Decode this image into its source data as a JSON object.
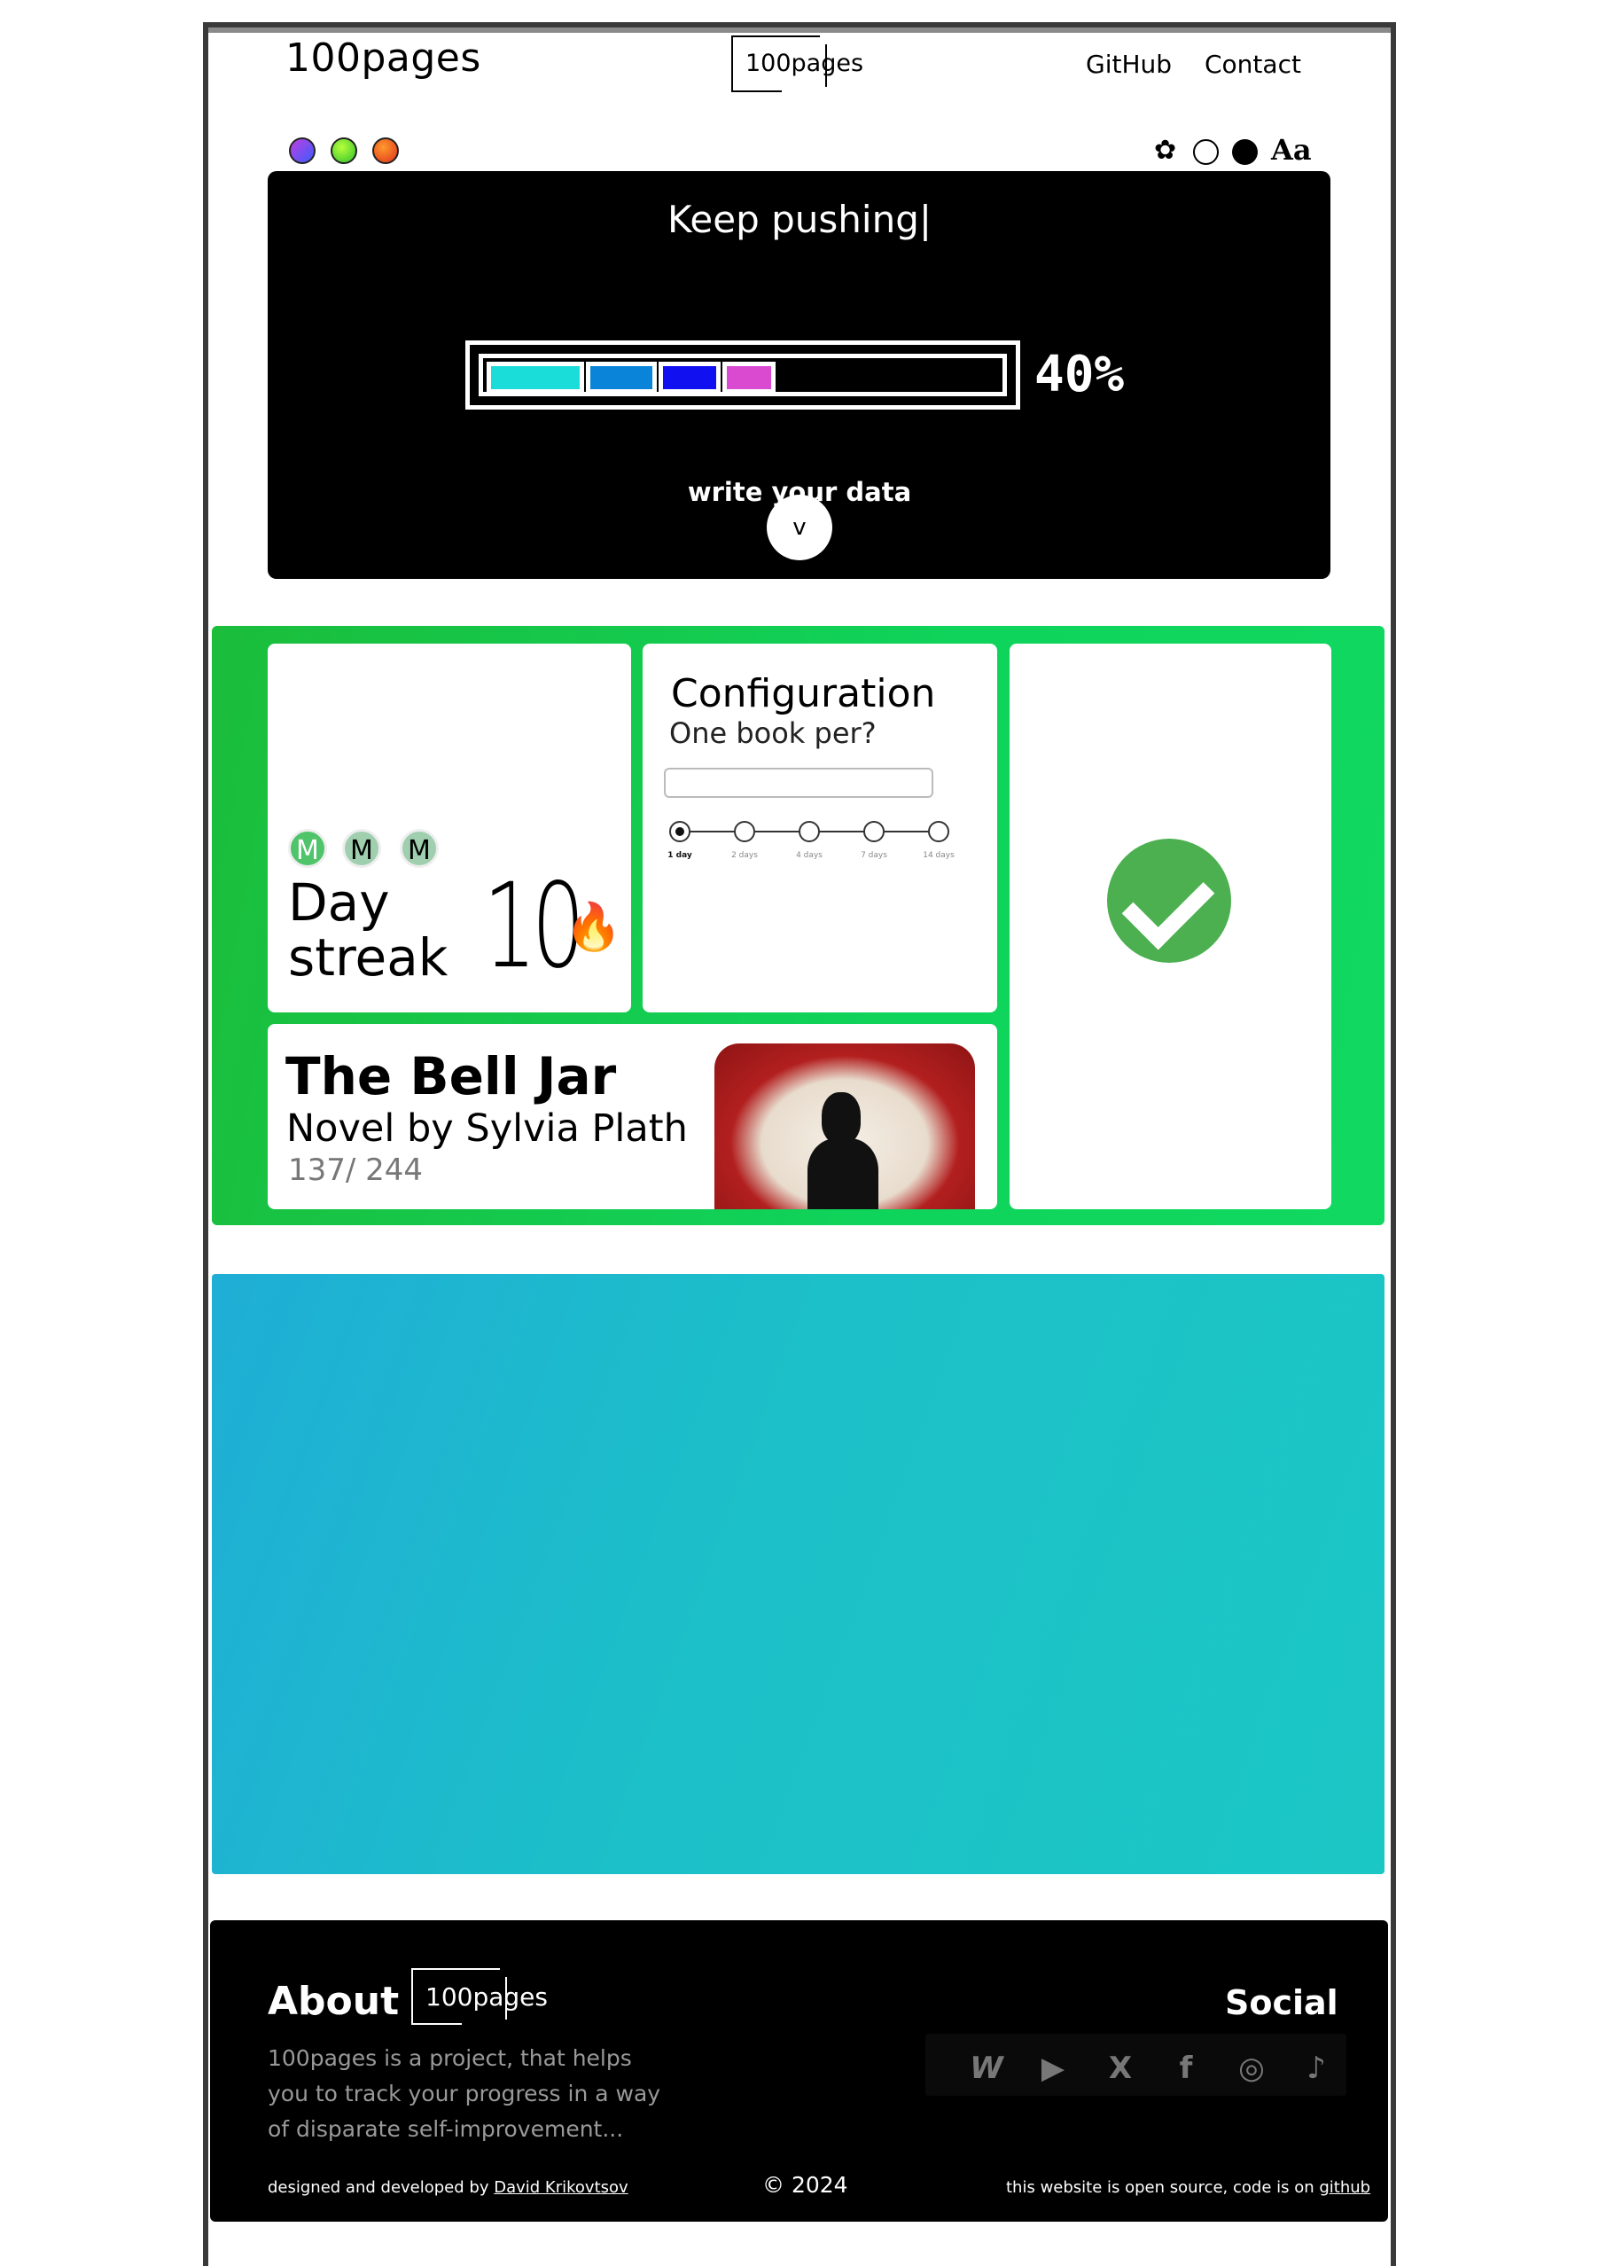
{
  "header": {
    "logo": "100pages",
    "center_logo": "100pages",
    "nav": [
      "GitHub",
      "Contact"
    ]
  },
  "theme": {
    "color_dots": [
      "#6a4cff",
      "#5bd12e",
      "#f06a24"
    ],
    "settings_icon": "gear-icon",
    "font_toggle": "Aa"
  },
  "hero": {
    "title": "Keep pushing|",
    "progress_percent": 40,
    "progress_label": "40%",
    "segments": [
      "#1adcd8",
      "#0a84d8",
      "#1010f0",
      "#d94ad0"
    ],
    "cta": "write your data",
    "toggle": "v"
  },
  "streak": {
    "avatars": [
      "M",
      "M",
      "M"
    ],
    "label_line1": "Day",
    "label_line2": "streak",
    "count": "10",
    "icon": "fire-icon"
  },
  "config": {
    "title": "Configuration",
    "subtitle": "One book per?",
    "input_value": "",
    "options": [
      "1 day",
      "2 days",
      "4 days",
      "7 days",
      "14 days"
    ],
    "selected": "1 day"
  },
  "book": {
    "title": "The Bell Jar",
    "subtitle": "Novel by Sylvia Plath",
    "pages": "137/ 244"
  },
  "footer": {
    "about": "About",
    "logo": "100pages",
    "description": "100pages is a project, that helps you to track your progress in a way of disparate self-improvement...",
    "social_title": "Social",
    "social_icons": [
      "webflow-icon",
      "youtube-icon",
      "x-icon",
      "facebook-icon",
      "instagram-icon",
      "tiktok-icon"
    ],
    "credit_prefix": "designed and developed by ",
    "credit_name": "David Krikovtsov",
    "copyright": "© 2024",
    "open_source_prefix": "this website is open source, code is on ",
    "open_source_link": "github"
  }
}
